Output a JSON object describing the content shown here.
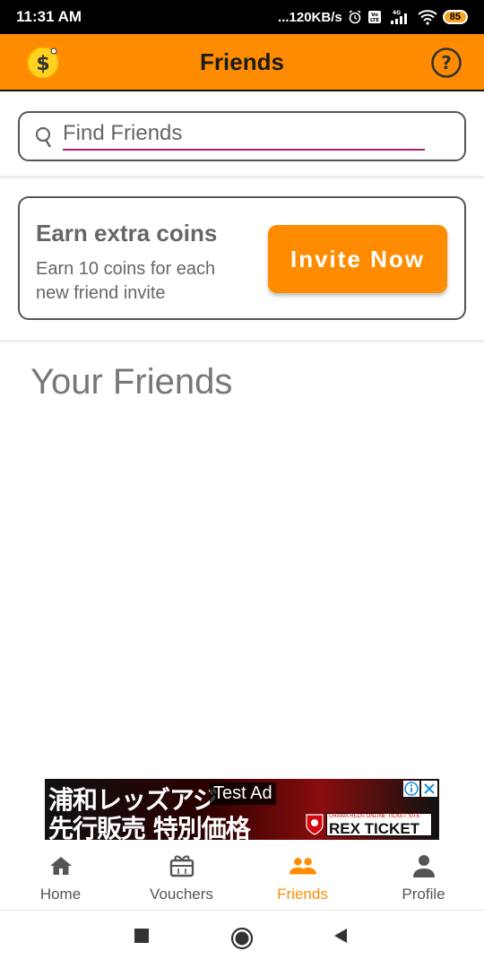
{
  "status_bar": {
    "time": "11:31 AM",
    "network_speed": "...120KB/s",
    "network_type": "4G",
    "battery": "85"
  },
  "app_bar": {
    "title": "Friends",
    "left_icon": "coin-dollar-icon",
    "right_icon": "help-icon",
    "accent_color": "#ff8c00"
  },
  "search": {
    "placeholder": "Find Friends",
    "value": ""
  },
  "invite": {
    "heading": "Earn extra coins",
    "text": "Earn 10 coins for each new friend invite",
    "button_label": "Invite Now"
  },
  "friends_section": {
    "heading": "Your Friends"
  },
  "ad": {
    "label": "Test Ad",
    "line1": "浦和レッズアジ",
    "line2": "先行販売 特別価格",
    "brand_small": "URAWA REDS ONLINE TICKET SITE",
    "brand": "REX TICKET"
  },
  "bottom_nav": {
    "items": [
      {
        "label": "Home",
        "icon": "home-icon",
        "active": false
      },
      {
        "label": "Vouchers",
        "icon": "voucher-icon",
        "active": false
      },
      {
        "label": "Friends",
        "icon": "friends-icon",
        "active": true
      },
      {
        "label": "Profile",
        "icon": "profile-icon",
        "active": false
      }
    ]
  }
}
